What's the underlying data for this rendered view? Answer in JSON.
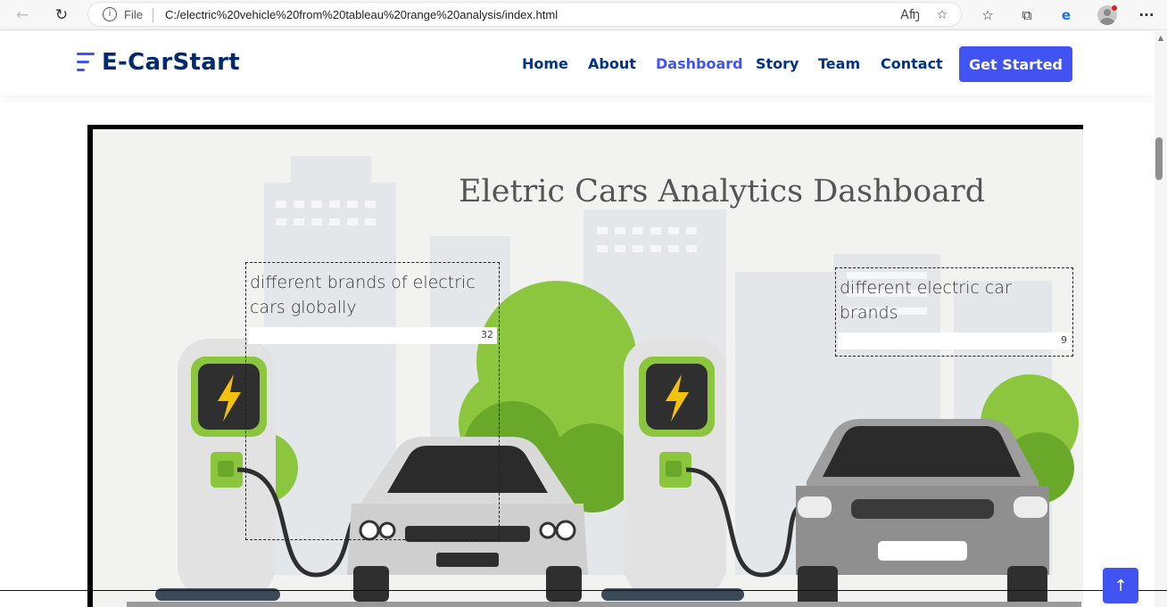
{
  "browser": {
    "back_icon": "arrow-left-icon",
    "reload_icon": "reload-icon",
    "file_label": "File",
    "url": "C:/electric%20vehicle%20from%20tableau%20range%20analysis/index.html",
    "read_aloud_glyph": "Aʩ",
    "star_glyph": "☆",
    "favorites_glyph": "☆",
    "collections_glyph": "⧉",
    "edge_glyph": "e",
    "more_glyph": "···"
  },
  "site": {
    "logo_text": "E-CarStart",
    "nav": [
      {
        "label": "Home"
      },
      {
        "label": "About"
      },
      {
        "label": "Dashboard"
      },
      {
        "label": "Story"
      },
      {
        "label": "Team"
      },
      {
        "label": "Contact"
      }
    ],
    "cta_label": "Get Started",
    "back_to_top_glyph": "↑"
  },
  "dashboard": {
    "title": "Eletric Cars Analytics Dashboard",
    "kpis": [
      {
        "label_line1": "different brands of electric",
        "label_line2": "cars globally",
        "value": "32"
      },
      {
        "label_line1": "different electric car",
        "label_line2": "brands",
        "value": "9"
      }
    ]
  },
  "colors": {
    "accent": "#4154f1",
    "nav_text": "#013289",
    "logo_text": "#012970"
  }
}
